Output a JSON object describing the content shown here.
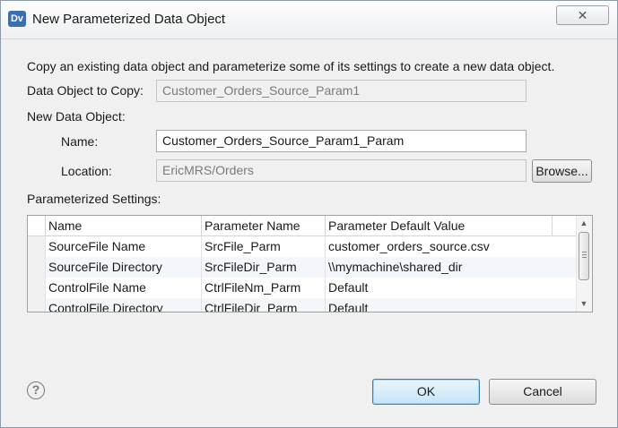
{
  "window": {
    "title": "New Parameterized Data Object",
    "app_icon_text": "Dv",
    "close_symbol": "✕"
  },
  "description": "Copy an existing data object and parameterize some of its settings to create a new data object.",
  "copy": {
    "label": "Data Object to Copy:",
    "value": "Customer_Orders_Source_Param1"
  },
  "new_object": {
    "label": "New Data Object:",
    "name_label": "Name:",
    "name_value": "Customer_Orders_Source_Param1_Param",
    "location_label": "Location:",
    "location_value": "EricMRS/Orders",
    "browse_label": "Browse..."
  },
  "settings": {
    "label": "Parameterized Settings:",
    "columns": [
      "Name",
      "Parameter Name",
      "Parameter Default Value"
    ],
    "rows": [
      [
        "SourceFile Name",
        "SrcFile_Parm",
        "customer_orders_source.csv"
      ],
      [
        "SourceFile Directory",
        "SrcFileDir_Parm",
        "\\\\mymachine\\shared_dir"
      ],
      [
        "ControlFile Name",
        "CtrlFileNm_Parm",
        "Default"
      ],
      [
        "ControlFile Directory",
        "CtrlFileDir_Parm",
        "Default"
      ]
    ]
  },
  "footer": {
    "help_symbol": "?",
    "ok_label": "OK",
    "cancel_label": "Cancel"
  }
}
